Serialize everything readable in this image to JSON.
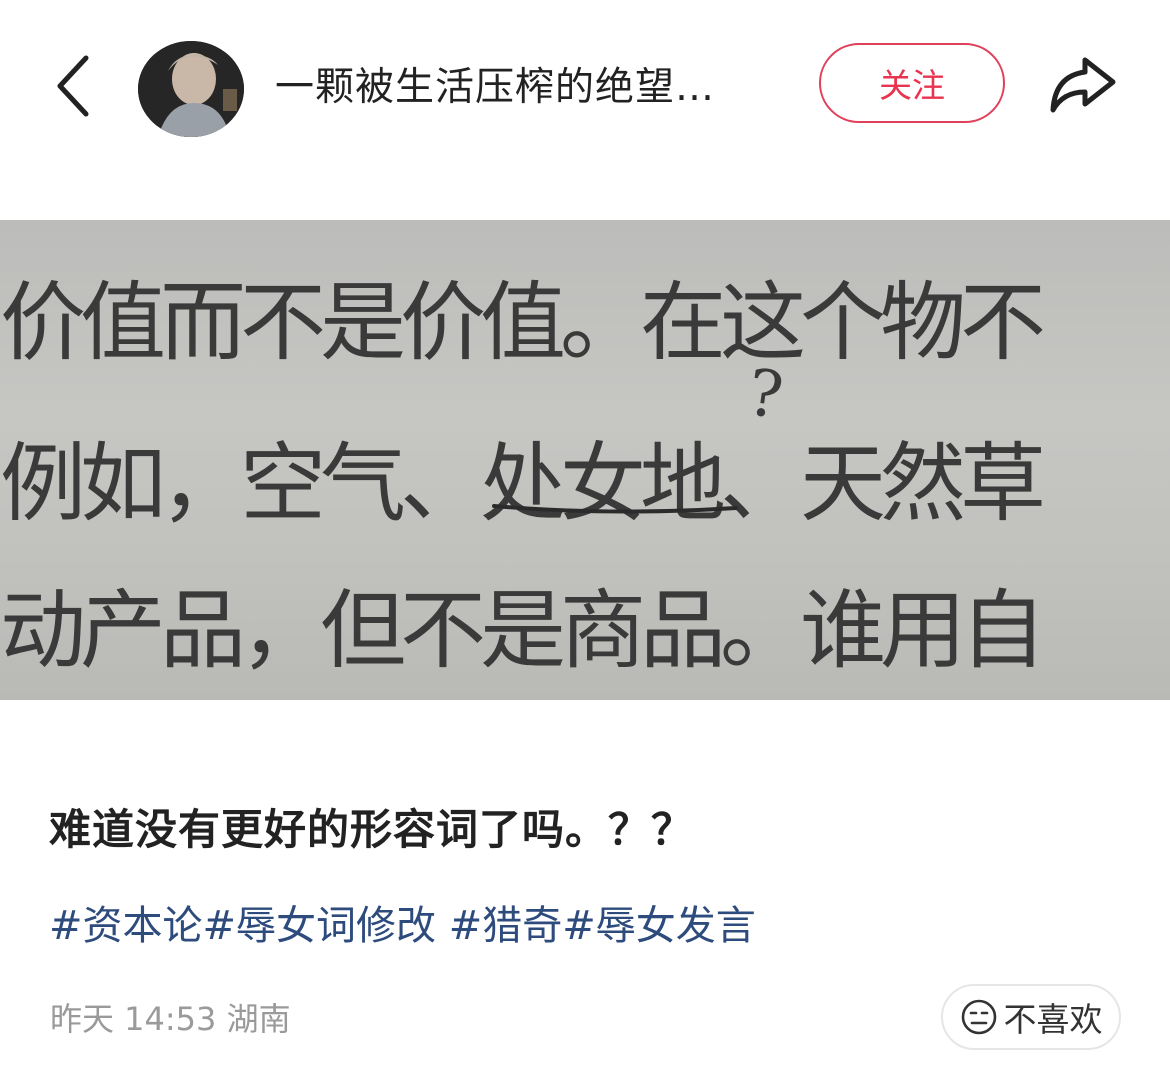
{
  "header": {
    "author_name": "一颗被生活压榨的绝望…",
    "follow_label": "关注"
  },
  "photo": {
    "line1": "价值而不是价值。在这个物不",
    "line2": "例如，空气、处女地、天然草",
    "line3": "动产品，但不是商品。谁用自",
    "annotation": "?"
  },
  "post": {
    "title": "难道没有更好的形容词了吗。？？",
    "tags": [
      "#资本论",
      "#辱女词修改 ",
      "#猎奇",
      "#辱女发言"
    ],
    "meta": "昨天 14:53 湖南",
    "dislike_label": "不喜欢"
  },
  "icons": {
    "back": "chevron-left-icon",
    "share": "share-arrow-icon",
    "dislike": "neutral-face-icon"
  },
  "colors": {
    "accent": "#e8344f",
    "tag": "#2d4b7c",
    "meta": "#9a9a9a"
  }
}
